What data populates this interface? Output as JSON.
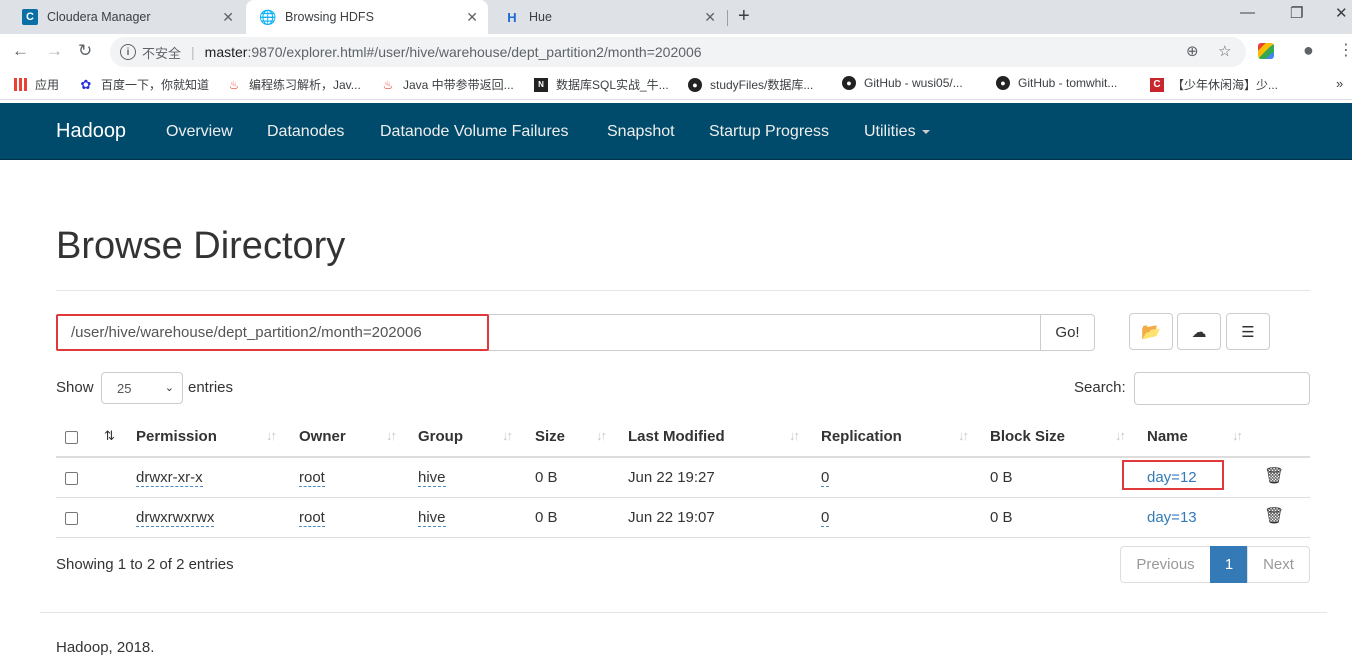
{
  "browser": {
    "tabs": [
      {
        "title": "Cloudera Manager",
        "icon": "cloudera-icon",
        "color": "#0a6fa5"
      },
      {
        "title": "Browsing HDFS",
        "icon": "globe-icon",
        "active": true
      },
      {
        "title": "Hue",
        "icon": "hue-icon",
        "color": "#1c6ad6"
      }
    ],
    "address": {
      "security_label": "不安全",
      "host": "master",
      "rest": ":9870/explorer.html#/user/hive/warehouse/dept_partition2/month=202006"
    },
    "bookmarks": [
      {
        "label": "应用",
        "icon": "apps-grid-icon"
      },
      {
        "label": "百度一下，你就知道",
        "icon": "baidu-paw-icon"
      },
      {
        "label": "编程练习解析，Jav...",
        "icon": "flame-icon"
      },
      {
        "label": "Java 中带参带返回...",
        "icon": "flame-icon"
      },
      {
        "label": "数据库SQL实战_牛...",
        "icon": "nowcoder-icon"
      },
      {
        "label": "studyFiles/数据库...",
        "icon": "github-icon"
      },
      {
        "label": "GitHub - wusi05/...",
        "icon": "github-icon"
      },
      {
        "label": "GitHub - tomwhit...",
        "icon": "github-icon"
      },
      {
        "label": "【少年休闲海】少...",
        "icon": "csdn-icon"
      }
    ]
  },
  "navbar": {
    "brand": "Hadoop",
    "links": [
      "Overview",
      "Datanodes",
      "Datanode Volume Failures",
      "Snapshot",
      "Startup Progress",
      "Utilities"
    ],
    "bg_color": "#004b6b"
  },
  "main": {
    "title": "Browse Directory",
    "path_value": "/user/hive/warehouse/dept_partition2/month=202006",
    "go_label": "Go!",
    "show_label": "Show",
    "page_size": "25",
    "entries_label": "entries",
    "search_label": "Search:",
    "search_value": "",
    "columns": [
      "Permission",
      "Owner",
      "Group",
      "Size",
      "Last Modified",
      "Replication",
      "Block Size",
      "Name"
    ],
    "rows": [
      {
        "permission": "drwxr-xr-x",
        "owner": "root",
        "group": "hive",
        "size": "0 B",
        "last_modified": "Jun 22 19:27",
        "replication": "0",
        "block_size": "0 B",
        "name": "day=12"
      },
      {
        "permission": "drwxrwxrwx",
        "owner": "root",
        "group": "hive",
        "size": "0 B",
        "last_modified": "Jun 22 19:07",
        "replication": "0",
        "block_size": "0 B",
        "name": "day=13"
      }
    ],
    "showing_text": "Showing 1 to 2 of 2 entries",
    "pager": {
      "prev": "Previous",
      "current": "1",
      "next": "Next"
    },
    "highlight_color": "#e0393b",
    "link_color": "#337ab7"
  },
  "footer": {
    "text": "Hadoop, 2018."
  }
}
